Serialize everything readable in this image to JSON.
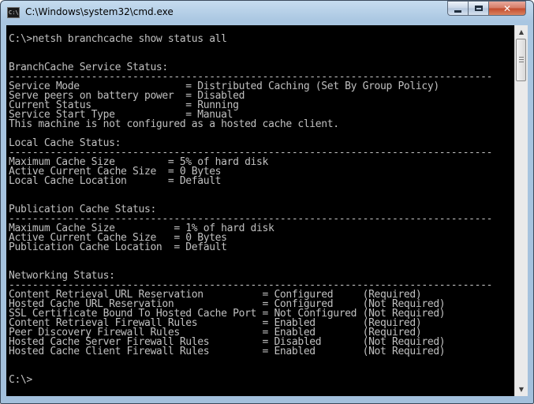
{
  "window": {
    "title": "C:\\Windows\\system32\\cmd.exe",
    "icon_text": "C:\\",
    "controls": {
      "minimize": "minimize-icon",
      "maximize": "maximize-icon",
      "close": "✕"
    }
  },
  "colors": {
    "console_bg": "#000000",
    "console_text": "#c0c0c0",
    "title_bar": "#a9c6e1",
    "close_button": "#c34a2c"
  },
  "console": {
    "lines": [
      "C:\\>netsh branchcache show status all",
      "",
      "",
      "BranchCache Service Status:",
      "----------------------------------------------------------------------------------",
      "Service Mode                  = Distributed Caching (Set By Group Policy)",
      "Serve peers on battery power  = Disabled",
      "Current Status                = Running",
      "Service Start Type            = Manual",
      "This machine is not configured as a hosted cache client.",
      "",
      "Local Cache Status:",
      "----------------------------------------------------------------------------------",
      "Maximum Cache Size         = 5% of hard disk",
      "Active Current Cache Size  = 0 Bytes",
      "Local Cache Location       = Default",
      "",
      "",
      "Publication Cache Status:",
      "----------------------------------------------------------------------------------",
      "Maximum Cache Size          = 1% of hard disk",
      "Active Current Cache Size   = 0 Bytes",
      "Publication Cache Location  = Default",
      "",
      "",
      "Networking Status:",
      "----------------------------------------------------------------------------------",
      "Content Retrieval URL Reservation          = Configured     (Required)",
      "Hosted Cache URL Reservation               = Configured     (Not Required)",
      "SSL Certificate Bound To Hosted Cache Port = Not Configured (Not Required)",
      "Content Retrieval Firewall Rules           = Enabled        (Required)",
      "Peer Discovery Firewall Rules              = Enabled        (Required)",
      "Hosted Cache Server Firewall Rules         = Disabled       (Not Required)",
      "Hosted Cache Client Firewall Rules         = Enabled        (Not Required)",
      "",
      "",
      "C:\\>"
    ]
  },
  "scrollbar": {
    "up_arrow": "▲",
    "down_arrow": "▼"
  }
}
